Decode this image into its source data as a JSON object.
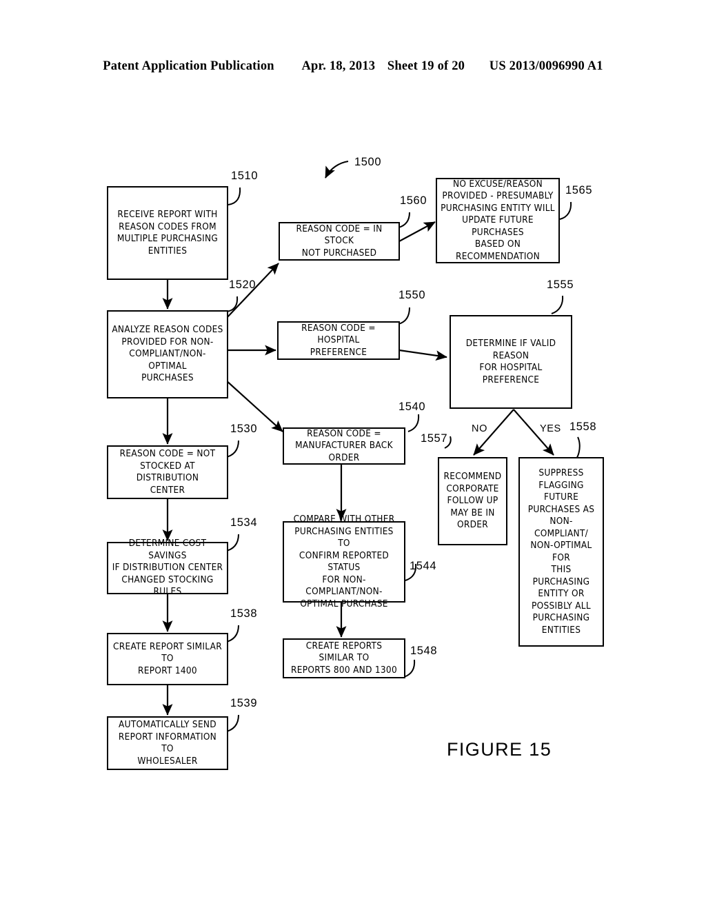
{
  "header": {
    "publication": "Patent Application Publication",
    "date": "Apr. 18, 2013",
    "sheet": "Sheet 19 of 20",
    "patent_number": "US 2013/0096990 A1"
  },
  "figure": {
    "caption": "FIGURE 15",
    "diagram_ref": "1500"
  },
  "nodes": [
    {
      "id": "1510",
      "ref": "1510",
      "text": "RECEIVE REPORT WITH\nREASON CODES FROM\nMULTIPLE PURCHASING\nENTITIES"
    },
    {
      "id": "1520",
      "ref": "1520",
      "text": "ANALYZE REASON CODES\nPROVIDED FOR NON-\nCOMPLIANT/NON-OPTIMAL\nPURCHASES"
    },
    {
      "id": "1530",
      "ref": "1530",
      "text": "REASON CODE = NOT\nSTOCKED AT DISTRIBUTION\nCENTER"
    },
    {
      "id": "1534",
      "ref": "1534",
      "text": "DETERMINE COST SAVINGS\nIF DISTRIBUTION CENTER\nCHANGED STOCKING RULES"
    },
    {
      "id": "1538",
      "ref": "1538",
      "text": "CREATE REPORT SIMILAR TO\nREPORT 1400"
    },
    {
      "id": "1539",
      "ref": "1539",
      "text": "AUTOMATICALLY SEND\nREPORT INFORMATION TO\nWHOLESALER"
    },
    {
      "id": "1560",
      "ref": "1560",
      "text": "REASON CODE = IN STOCK\nNOT PURCHASED"
    },
    {
      "id": "1565",
      "ref": "1565",
      "text": "NO EXCUSE/REASON\nPROVIDED - PRESUMABLY\nPURCHASING ENTITY WILL\nUPDATE FUTURE PURCHASES\nBASED ON RECOMMENDATION"
    },
    {
      "id": "1550",
      "ref": "1550",
      "text": "REASON CODE = HOSPITAL\nPREFERENCE"
    },
    {
      "id": "1555",
      "ref": "1555",
      "text": "DETERMINE IF VALID REASON\nFOR HOSPITAL PREFERENCE"
    },
    {
      "id": "1540",
      "ref": "1540",
      "text": "REASON CODE =\nMANUFACTURER BACK ORDER"
    },
    {
      "id": "1544",
      "ref": "1544",
      "text": "COMPARE WITH OTHER\nPURCHASING ENTITIES TO\nCONFIRM REPORTED STATUS\nFOR NON-COMPLIANT/NON-\nOPTIMAL PURCHASE"
    },
    {
      "id": "1548",
      "ref": "1548",
      "text": "CREATE REPORTS SIMILAR TO\nREPORTS 800 AND 1300"
    },
    {
      "id": "1557",
      "ref": "1557",
      "text": "RECOMMEND\nCORPORATE\nFOLLOW UP\nMAY BE IN\nORDER"
    },
    {
      "id": "1558",
      "ref": "1558",
      "text": "SUPPRESS\nFLAGGING FUTURE\nPURCHASES AS\nNON-COMPLIANT/\nNON-OPTIMAL FOR\nTHIS PURCHASING\nENTITY OR\nPOSSIBLY ALL\nPURCHASING\nENTITIES"
    }
  ],
  "branches": {
    "no_label": "NO",
    "yes_label": "YES"
  }
}
